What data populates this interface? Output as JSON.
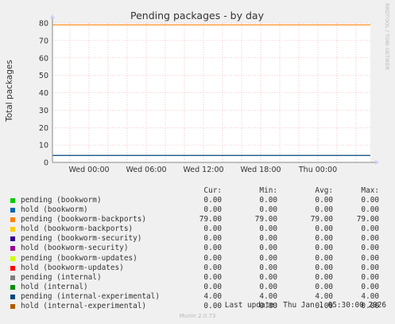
{
  "chart_data": {
    "type": "line",
    "title": "Pending packages - by day",
    "ylabel": "Total packages",
    "side_label": "RRDTOOL / TOBI OETIKER",
    "ylim": [
      0,
      80
    ],
    "y_ticks": [
      "0",
      "10",
      "20",
      "30",
      "40",
      "50",
      "60",
      "70",
      "80"
    ],
    "x_ticks": [
      "Wed 00:00",
      "Wed 06:00",
      "Wed 12:00",
      "Wed 18:00",
      "Thu 00:00"
    ],
    "grid": true,
    "series": [
      {
        "name": "pending (bookworm)",
        "color": "#00cc00",
        "values": [
          0.0,
          0.0
        ],
        "cur": "0.00",
        "min": "0.00",
        "avg": "0.00",
        "max": "0.00"
      },
      {
        "name": "hold (bookworm)",
        "color": "#0066b3",
        "values": [
          0.0,
          0.0
        ],
        "cur": "0.00",
        "min": "0.00",
        "avg": "0.00",
        "max": "0.00"
      },
      {
        "name": "pending (bookworm-backports)",
        "color": "#ff8000",
        "values": [
          79.0,
          79.0
        ],
        "cur": "79.00",
        "min": "79.00",
        "avg": "79.00",
        "max": "79.00"
      },
      {
        "name": "hold (bookworm-backports)",
        "color": "#ffcc00",
        "values": [
          0.0,
          0.0
        ],
        "cur": "0.00",
        "min": "0.00",
        "avg": "0.00",
        "max": "0.00"
      },
      {
        "name": "pending (bookworm-security)",
        "color": "#330099",
        "values": [
          0.0,
          0.0
        ],
        "cur": "0.00",
        "min": "0.00",
        "avg": "0.00",
        "max": "0.00"
      },
      {
        "name": "hold (bookworm-security)",
        "color": "#990099",
        "values": [
          0.0,
          0.0
        ],
        "cur": "0.00",
        "min": "0.00",
        "avg": "0.00",
        "max": "0.00"
      },
      {
        "name": "pending (bookworm-updates)",
        "color": "#ccff00",
        "values": [
          0.0,
          0.0
        ],
        "cur": "0.00",
        "min": "0.00",
        "avg": "0.00",
        "max": "0.00"
      },
      {
        "name": "hold (bookworm-updates)",
        "color": "#ff0000",
        "values": [
          0.0,
          0.0
        ],
        "cur": "0.00",
        "min": "0.00",
        "avg": "0.00",
        "max": "0.00"
      },
      {
        "name": "pending (internal)",
        "color": "#808080",
        "values": [
          0.0,
          0.0
        ],
        "cur": "0.00",
        "min": "0.00",
        "avg": "0.00",
        "max": "0.00"
      },
      {
        "name": "hold (internal)",
        "color": "#008f00",
        "values": [
          0.0,
          0.0
        ],
        "cur": "0.00",
        "min": "0.00",
        "avg": "0.00",
        "max": "0.00"
      },
      {
        "name": "pending (internal-experimental)",
        "color": "#00487d",
        "values": [
          4.0,
          4.0
        ],
        "cur": "4.00",
        "min": "4.00",
        "avg": "4.00",
        "max": "4.00"
      },
      {
        "name": "hold (internal-experimental)",
        "color": "#b35a00",
        "values": [
          0.0,
          0.0
        ],
        "cur": "0.00",
        "min": "0.00",
        "avg": "0.00",
        "max": "0.00"
      }
    ]
  },
  "legend_headers": {
    "cur": "Cur:",
    "min": "Min:",
    "avg": "Avg:",
    "max": "Max:"
  },
  "last_update": "Last update: Thu Jan  1 05:30:00 2026",
  "footer": "Munin 2.0.73"
}
